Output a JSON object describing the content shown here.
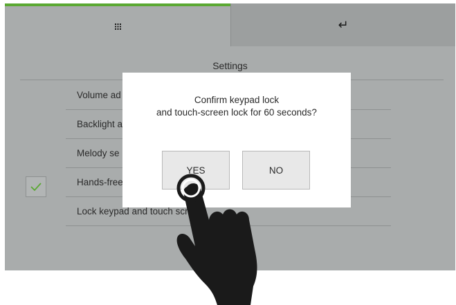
{
  "header": {
    "menu_icon": "grid-icon",
    "back_icon": "return-arrow-icon",
    "back_glyph": "↵"
  },
  "settings": {
    "title": "Settings",
    "items": [
      {
        "label": "Volume ad"
      },
      {
        "label": "Backlight a"
      },
      {
        "label": "Melody se"
      },
      {
        "label": "Hands-free"
      },
      {
        "label": "Lock keypad and touch screen"
      }
    ],
    "checked_item": "Hands-free"
  },
  "dialog": {
    "line1": "Confirm keypad lock",
    "line2": "and touch-screen lock for 60 seconds?",
    "yes_label": "YES",
    "no_label": "NO"
  },
  "colors": {
    "accent_green": "#5aa832",
    "screen_gray": "#a9acac",
    "dialog_bg": "#ffffff"
  }
}
